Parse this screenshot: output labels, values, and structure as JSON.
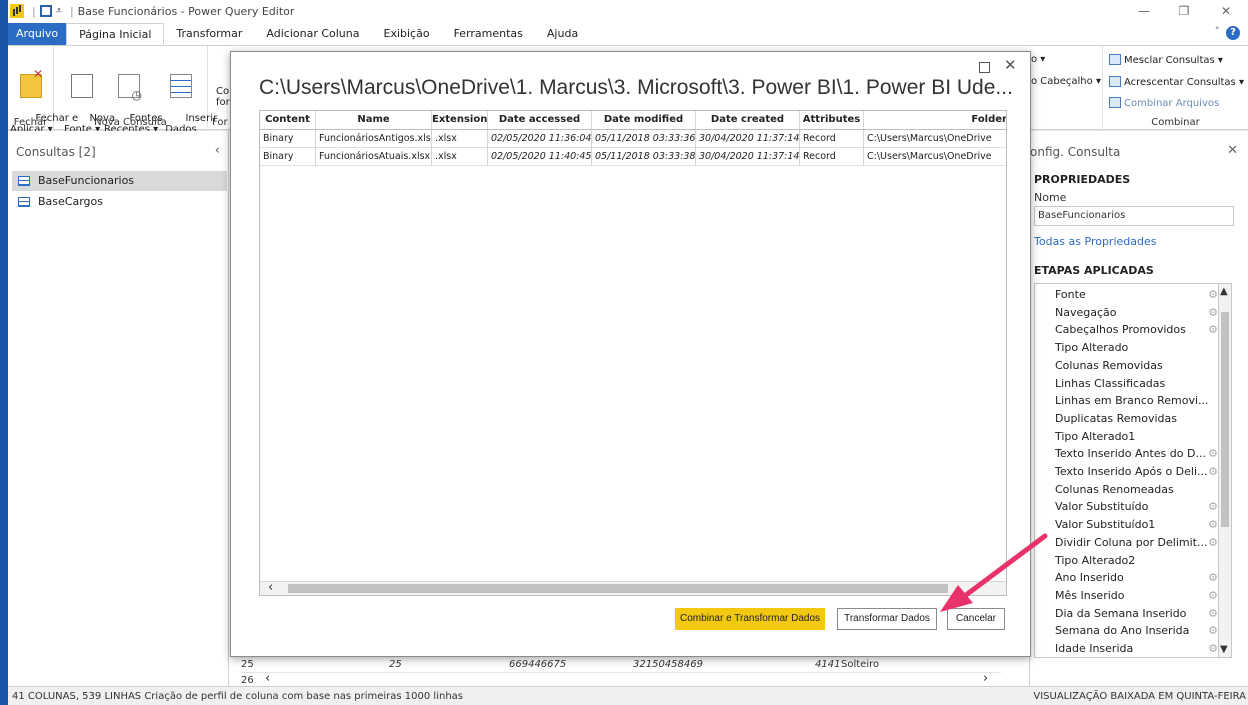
{
  "window": {
    "title": "Base Funcionários - Power Query Editor",
    "minimize": "—",
    "restore": "❐",
    "close": "✕"
  },
  "ribbon_tabs": [
    "Arquivo",
    "Página Inicial",
    "Transformar",
    "Adicionar Coluna",
    "Exibição",
    "Ferramentas",
    "Ajuda"
  ],
  "ribbon": {
    "fechar_aplicar": "Fechar e\nAplicar ▾",
    "nova_fonte": "Nova\nFonte ▾",
    "fontes_recentes": "Fontes\nRecentes ▾",
    "inserir_dados": "Inserir\nDados",
    "con_for": "Con\nfor",
    "group_fechar": "Fechar",
    "group_nova_consulta": "Nova Consulta",
    "group_for": "For",
    "cabecalho": "o Cabeçalho ▾",
    "o_marker": "o ▾",
    "mesclar": "Mesclar Consultas ▾",
    "acrescentar": "Acrescentar Consultas ▾",
    "combinar_arquivos": "Combinar Arquivos",
    "group_combinar": "Combinar"
  },
  "left_pane": {
    "header": "Consultas [2]",
    "collapse_icon": "‹",
    "queries": [
      "BaseFuncionarios",
      "BaseCargos"
    ]
  },
  "right_pane": {
    "title": "onfig. Consulta",
    "properties_header": "PROPRIEDADES",
    "name_label": "Nome",
    "name_value": "BaseFuncionarios",
    "all_properties_link": "Todas as Propriedades",
    "steps_header": "ETAPAS APLICADAS",
    "steps": [
      {
        "label": "Fonte",
        "gear": true
      },
      {
        "label": "Navegação",
        "gear": true
      },
      {
        "label": "Cabeçalhos Promovidos",
        "gear": true
      },
      {
        "label": "Tipo Alterado",
        "gear": false
      },
      {
        "label": "Colunas Removidas",
        "gear": false
      },
      {
        "label": "Linhas Classificadas",
        "gear": false
      },
      {
        "label": "Linhas em Branco Removi...",
        "gear": false
      },
      {
        "label": "Duplicatas Removidas",
        "gear": false
      },
      {
        "label": "Tipo Alterado1",
        "gear": false
      },
      {
        "label": "Texto Inserido Antes do D...",
        "gear": true
      },
      {
        "label": "Texto Inserido Após o Deli...",
        "gear": true
      },
      {
        "label": "Colunas Renomeadas",
        "gear": false
      },
      {
        "label": "Valor Substituído",
        "gear": true
      },
      {
        "label": "Valor Substituído1",
        "gear": true
      },
      {
        "label": "Dividir Coluna por Delimit...",
        "gear": true
      },
      {
        "label": "Tipo Alterado2",
        "gear": false
      },
      {
        "label": "Ano Inserido",
        "gear": true
      },
      {
        "label": "Mês Inserido",
        "gear": true
      },
      {
        "label": "Dia da Semana Inserido",
        "gear": true
      },
      {
        "label": "Semana do Ano Inserida",
        "gear": true
      },
      {
        "label": "Idade Inserida",
        "gear": true
      }
    ]
  },
  "background_grid": {
    "row25": {
      "num": "25",
      "col1": "25",
      "col2": "669446675",
      "col3": "32150458469",
      "col4": "4141",
      "col5": "Solteiro"
    },
    "row26": {
      "num": "26"
    }
  },
  "dialog": {
    "path": "C:\\Users\\Marcus\\OneDrive\\1. Marcus\\3. Microsoft\\3. Power BI\\1. Power BI Ude...",
    "columns": [
      "Content",
      "Name",
      "Extension",
      "Date accessed",
      "Date modified",
      "Date created",
      "Attributes",
      "Folder"
    ],
    "rows": [
      [
        "Binary",
        "FuncionáriosAntigos.xlsx",
        ".xlsx",
        "02/05/2020 11:36:04",
        "05/11/2018 03:33:36",
        "30/04/2020 11:37:14",
        "Record",
        "C:\\Users\\Marcus\\OneDrive"
      ],
      [
        "Binary",
        "FuncionáriosAtuais.xlsx",
        ".xlsx",
        "02/05/2020 11:40:45",
        "05/11/2018 03:33:38",
        "30/04/2020 11:37:14",
        "Record",
        "C:\\Users\\Marcus\\OneDrive"
      ]
    ],
    "btn_combine": "Combinar e Transformar Dados",
    "btn_transform": "Transformar Dados",
    "btn_cancel": "Cancelar"
  },
  "status": {
    "left": "41 COLUNAS, 539 LINHAS   Criação de perfil de coluna com base nas primeiras 1000 linhas",
    "right": "VISUALIZAÇÃO BAIXADA EM QUINTA-FEIRA"
  },
  "colors": {
    "accent": "#2b6cc4",
    "primary_button": "#f2c811",
    "annotation_arrow": "#e8336a"
  }
}
